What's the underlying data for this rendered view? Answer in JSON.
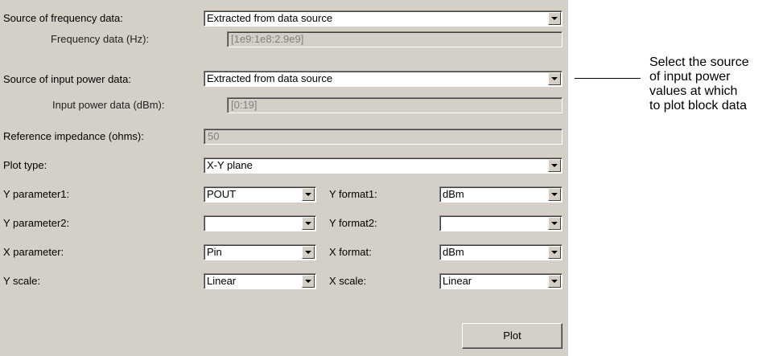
{
  "form": {
    "source_freq": {
      "label": "Source of frequency data:",
      "value": "Extracted from data source"
    },
    "freq_data": {
      "label": "Frequency data (Hz):",
      "value": "[1e9:1e8:2.9e9]"
    },
    "source_power": {
      "label": "Source of input power data:",
      "value": "Extracted from data source"
    },
    "power_data": {
      "label": "Input power data (dBm):",
      "value": "[0:19]"
    },
    "ref_imp": {
      "label": "Reference impedance (ohms):",
      "value": "50"
    },
    "plot_type": {
      "label": "Plot type:",
      "value": "X-Y plane"
    },
    "y_param1": {
      "label": "Y parameter1:",
      "value": "POUT"
    },
    "y_format1": {
      "label": "Y format1:",
      "value": "dBm"
    },
    "y_param2": {
      "label": "Y parameter2:",
      "value": ""
    },
    "y_format2": {
      "label": "Y format2:",
      "value": ""
    },
    "x_param": {
      "label": "X parameter:",
      "value": "Pin"
    },
    "x_format": {
      "label": "X format:",
      "value": "dBm"
    },
    "y_scale": {
      "label": "Y scale:",
      "value": "Linear"
    },
    "x_scale": {
      "label": "X scale:",
      "value": "Linear"
    },
    "plot_button": "Plot"
  },
  "annotation": {
    "lines": [
      "Select the source",
      "of input power",
      "values at which",
      "to plot block data"
    ]
  },
  "icons": {
    "dropdown": "chevron-down-icon"
  },
  "colors": {
    "panel": "#d4d0c8",
    "field_bg": "#ffffff",
    "disabled_text": "#808080"
  }
}
